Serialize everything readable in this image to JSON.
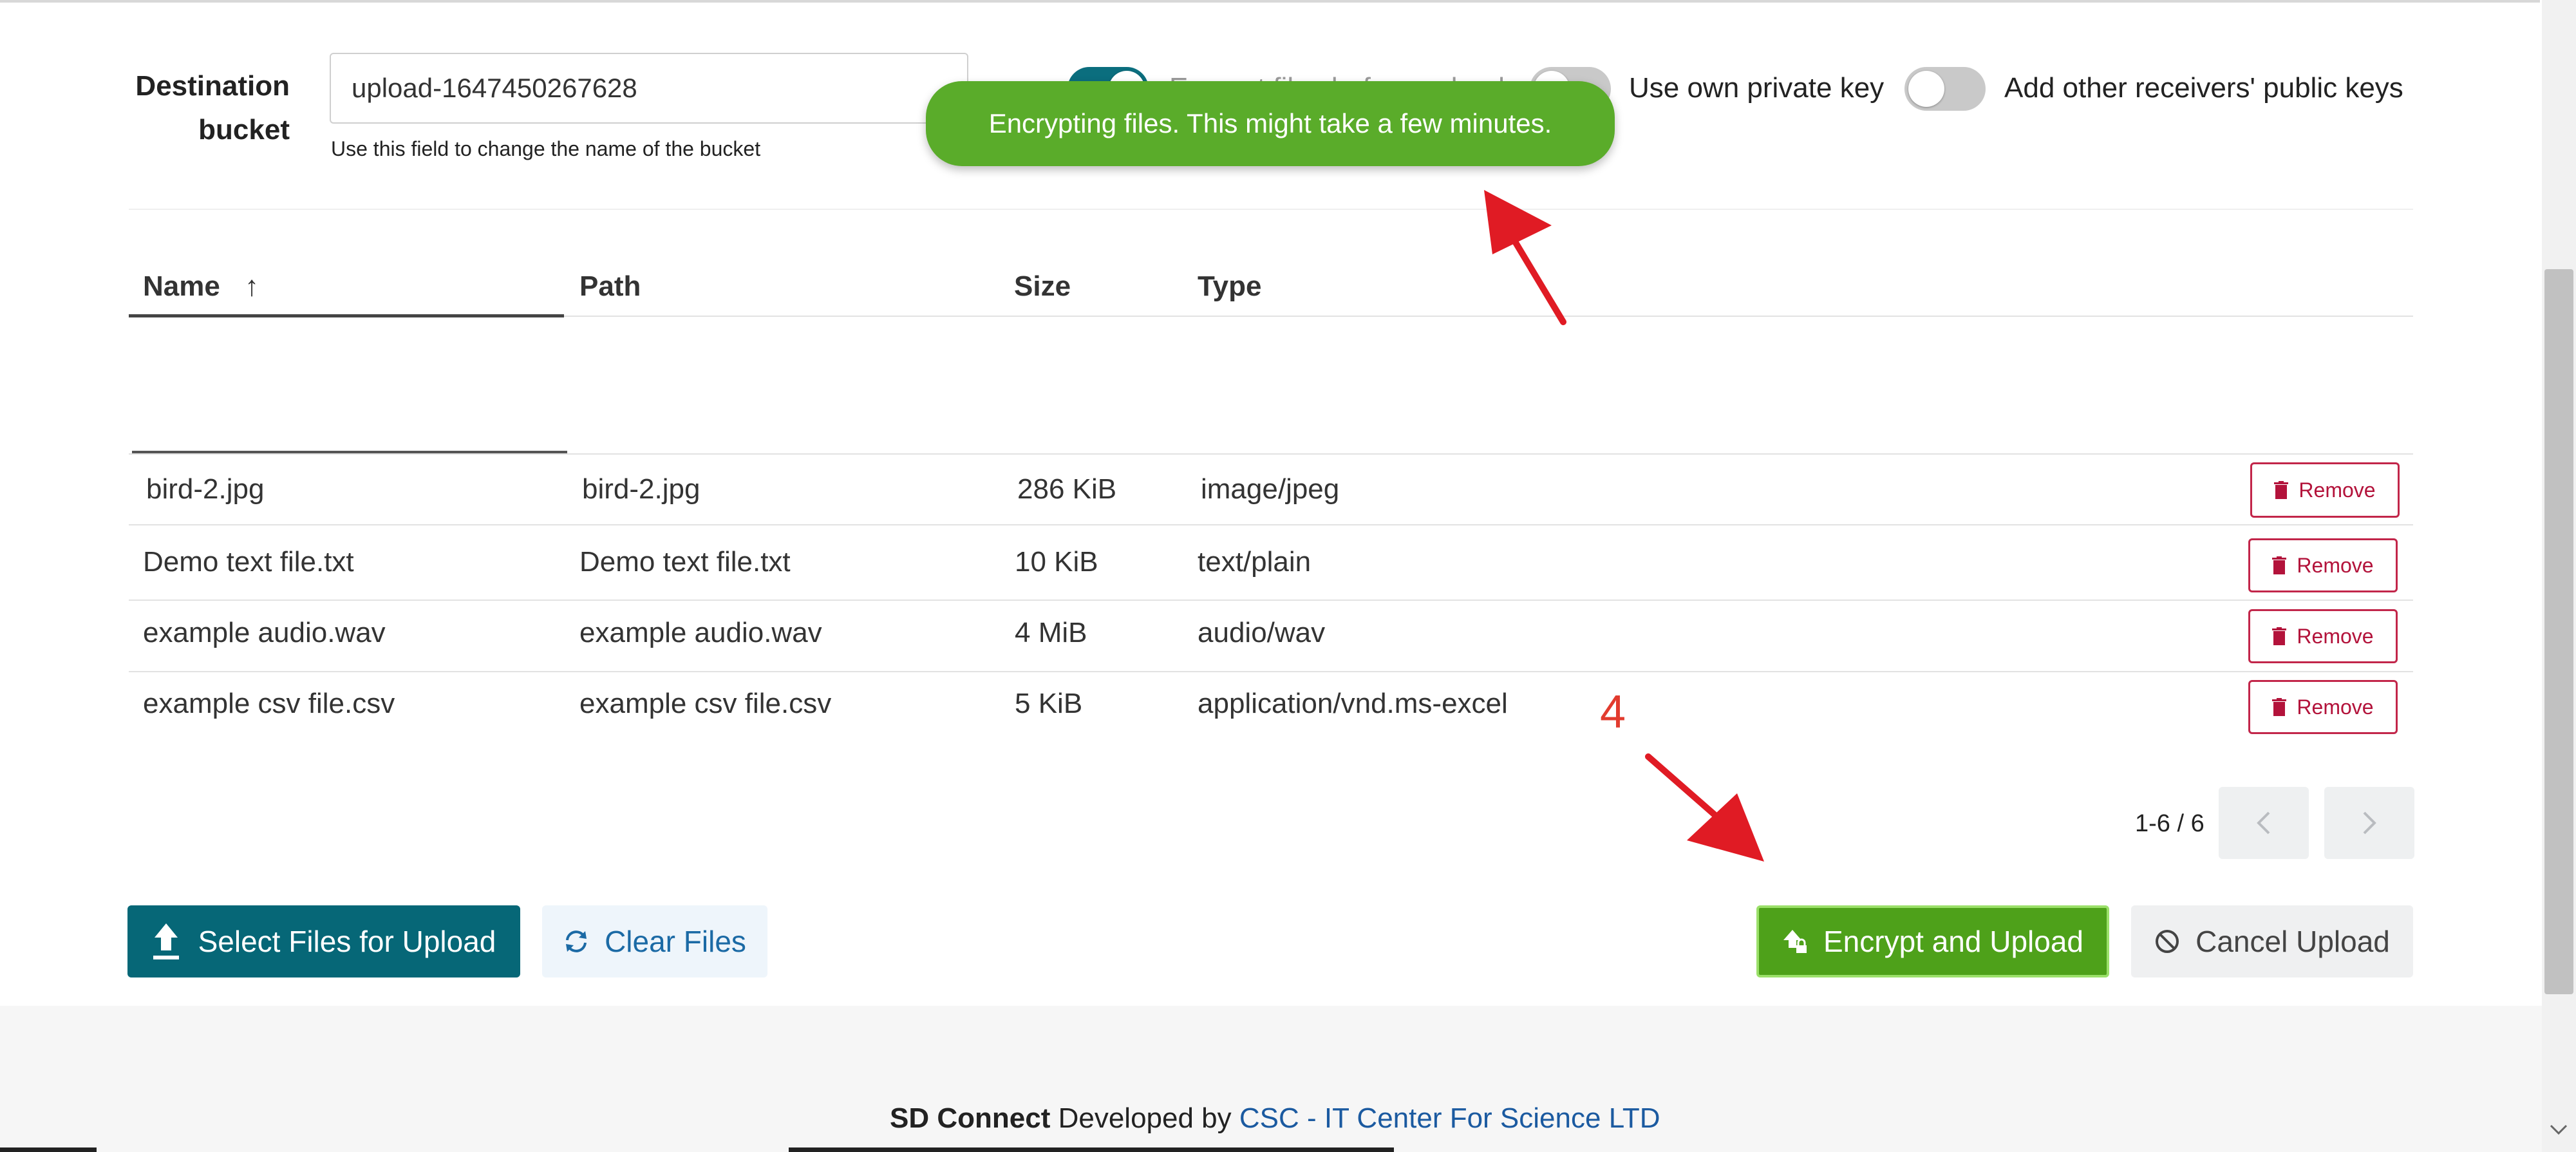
{
  "destination": {
    "label_line1": "Destination",
    "label_line2": "bucket",
    "value": "upload-1647450267628",
    "helper": "Use this field to change the name of the bucket"
  },
  "toggles": [
    {
      "label": "Encrypt files before upload",
      "state": "on"
    },
    {
      "label": "Use own private key",
      "state": "off"
    },
    {
      "label": "Add other receivers' public keys",
      "state": "off"
    }
  ],
  "toast": {
    "message": "Encrypting files. This might take a few minutes."
  },
  "table": {
    "headers": {
      "name": "Name",
      "path": "Path",
      "size": "Size",
      "type": "Type"
    },
    "sort_indicator": "↑",
    "rows": [
      {
        "name": "bird-2.jpg",
        "path": "bird-2.jpg",
        "size": "286 KiB",
        "type": "image/jpeg",
        "action": "Remove"
      },
      {
        "name": "Demo text file.txt",
        "path": "Demo text file.txt",
        "size": "10 KiB",
        "type": "text/plain",
        "action": "Remove"
      },
      {
        "name": "example audio.wav",
        "path": "example audio.wav",
        "size": "4 MiB",
        "type": "audio/wav",
        "action": "Remove"
      },
      {
        "name": "example csv file.csv",
        "path": "example csv file.csv",
        "size": "5 KiB",
        "type": "application/vnd.ms-excel",
        "action": "Remove"
      }
    ]
  },
  "pagination": {
    "range": "1-6 / 6"
  },
  "actions": {
    "select_files": "Select Files for Upload",
    "clear_files": "Clear Files",
    "encrypt_upload": "Encrypt and Upload",
    "cancel_upload": "Cancel Upload"
  },
  "annotation": {
    "step": "4"
  },
  "footer": {
    "brand": "SD Connect",
    "developed_by": " Developed by ",
    "org": "CSC - IT Center For Science LTD"
  },
  "colors": {
    "accent": "#066777",
    "toast": "#5aac2a",
    "encrypt_button": "#4ea11a",
    "remove": "#b3133b",
    "annotation": "#e23b2e"
  }
}
